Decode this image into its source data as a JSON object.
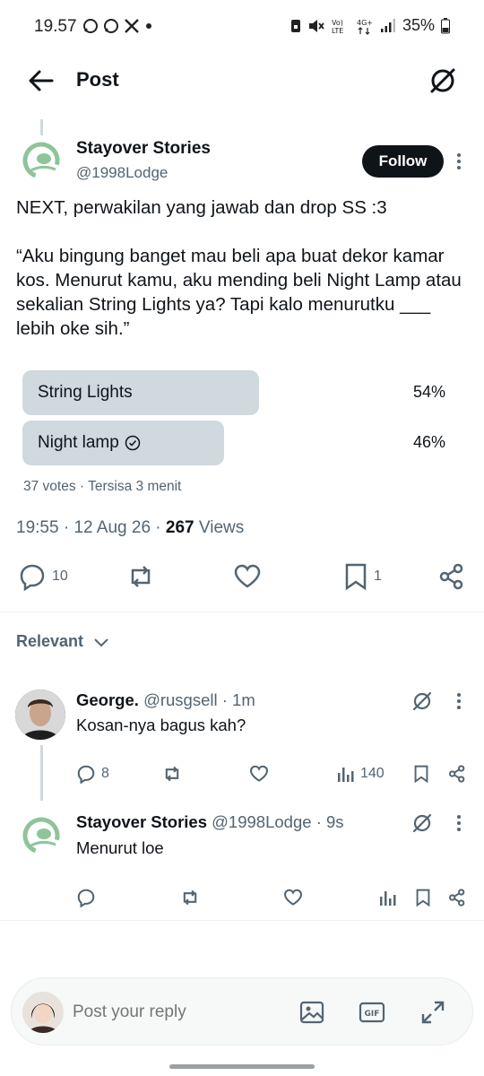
{
  "status_bar": {
    "time": "19.57",
    "battery": "35%",
    "icons": [
      "chat-bubble-icon",
      "chat-bubble-icon",
      "x-logo-icon",
      "dot-icon",
      "volte-icon",
      "4g-icon",
      "signal-icon",
      "battery-icon",
      "mute-icon",
      "save-icon"
    ]
  },
  "header": {
    "title": "Post",
    "back_icon": "arrow-left-icon",
    "grok_icon": "grok-icon"
  },
  "post": {
    "author_name": "Stayover Stories",
    "author_handle": "@1998Lodge",
    "follow_label": "Follow",
    "text_line1": "NEXT, perwakilan yang jawab dan drop SS :3",
    "text_quote": "“Aku bingung banget mau beli apa buat dekor kamar kos. Menurut kamu, aku mending beli Night Lamp atau sekalian String Lights ya? Tapi kalo menurutku ___ lebih oke sih.”",
    "poll": {
      "options": [
        {
          "label": "String Lights",
          "percent": "54%",
          "share": 0.54,
          "selected": false
        },
        {
          "label": "Night lamp",
          "percent": "46%",
          "share": 0.46,
          "selected": true
        }
      ],
      "votes": "37 votes",
      "separator": "·",
      "remaining": "Tersisa 3 menit"
    },
    "time": "19:55",
    "date": "12 Aug 26",
    "views_count": "267",
    "views_label": "Views",
    "replies": "10",
    "retweets": "",
    "likes": "",
    "bookmarks": "1"
  },
  "sort": {
    "label": "Relevant"
  },
  "replies": [
    {
      "name": "George.",
      "handle": "@rusgsell",
      "time": "1m",
      "text": "Kosan-nya bagus kah?",
      "reply_count": "8",
      "views": "140"
    },
    {
      "name": "Stayover Stories",
      "handle": "@1998Lodge",
      "time": "9s",
      "text": "Menurut loe",
      "reply_count": "",
      "views": ""
    }
  ],
  "composer": {
    "placeholder": "Post your reply",
    "icons": [
      "image-icon",
      "gif-icon",
      "expand-icon"
    ]
  },
  "colors": {
    "text": "#0f1419",
    "secondary": "#536471",
    "poll_bar": "#cfd9de",
    "follow_bg": "#0f1419"
  }
}
